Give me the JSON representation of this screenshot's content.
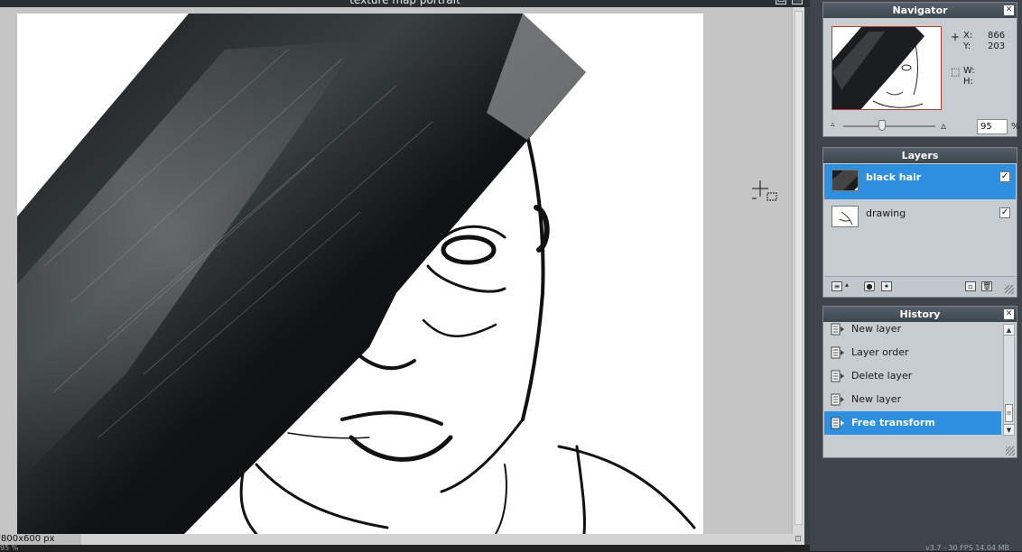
{
  "document": {
    "title": "texture map portrait",
    "size_label": "800x600 px",
    "zoom_readout": "95 %",
    "corner_symbol": "⊡"
  },
  "navigator": {
    "title": "Navigator",
    "x_label": "X:",
    "x_value": "866",
    "y_label": "Y:",
    "y_value": "203",
    "w_label": "W:",
    "h_label": "H:",
    "zoom_value": "95",
    "zoom_unit": "%",
    "zoom_slider_fraction": 0.42
  },
  "layers": {
    "title": "Layers",
    "items": [
      {
        "name": "black hair",
        "visible": true,
        "selected": true
      },
      {
        "name": "drawing",
        "visible": true,
        "selected": false
      }
    ]
  },
  "history": {
    "title": "History",
    "items": [
      {
        "label": "New layer",
        "selected": false
      },
      {
        "label": "Layer order",
        "selected": false
      },
      {
        "label": "Delete layer",
        "selected": false
      },
      {
        "label": "New layer",
        "selected": false
      },
      {
        "label": "Free transform",
        "selected": true
      }
    ]
  },
  "footer": {
    "version_text": "v3.7 - 30 FPS 14.04 MB"
  },
  "colors": {
    "accent": "#2c8fe0",
    "panel_bg": "#c7ccd1",
    "header": "#3d464e"
  }
}
